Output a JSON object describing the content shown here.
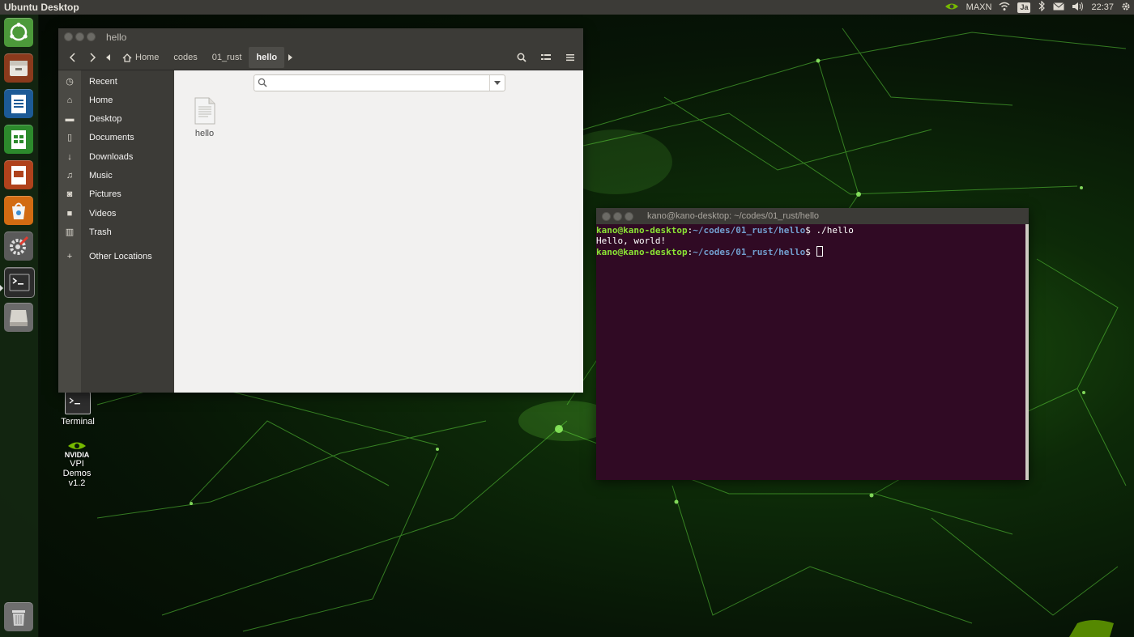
{
  "top_panel": {
    "title": "Ubuntu Desktop",
    "power_mode": "MAXN",
    "keyboard": "Ja",
    "clock": "22:37"
  },
  "launcher": {
    "items": [
      {
        "name": "ubuntu-dash-icon"
      },
      {
        "name": "files-icon"
      },
      {
        "name": "writer-icon"
      },
      {
        "name": "calc-icon"
      },
      {
        "name": "impress-icon"
      },
      {
        "name": "software-icon"
      },
      {
        "name": "settings-icon"
      },
      {
        "name": "terminal-icon"
      },
      {
        "name": "drive-icon"
      },
      {
        "name": "trash-icon"
      }
    ]
  },
  "desktop": {
    "icons": [
      {
        "label": "Terminal"
      },
      {
        "brand": "NVIDIA",
        "label": "VPI Demos v1.2"
      }
    ]
  },
  "files_window": {
    "title": "hello",
    "breadcrumbs": [
      "Home",
      "codes",
      "01_rust",
      "hello"
    ],
    "sidebar": [
      {
        "icon": "clock-icon",
        "label": "Recent"
      },
      {
        "icon": "home-icon",
        "label": "Home"
      },
      {
        "icon": "folder-icon",
        "label": "Desktop"
      },
      {
        "icon": "document-icon",
        "label": "Documents"
      },
      {
        "icon": "download-icon",
        "label": "Downloads"
      },
      {
        "icon": "music-icon",
        "label": "Music"
      },
      {
        "icon": "camera-icon",
        "label": "Pictures"
      },
      {
        "icon": "video-icon",
        "label": "Videos"
      },
      {
        "icon": "trash-icon",
        "label": "Trash"
      },
      {
        "icon": "plus-icon",
        "label": "Other Locations"
      }
    ],
    "search": {
      "placeholder": ""
    },
    "files": [
      {
        "name": "hello"
      }
    ]
  },
  "terminal": {
    "title": "kano@kano-desktop: ~/codes/01_rust/hello",
    "lines": [
      {
        "user": "kano@kano-desktop",
        "sep": ":",
        "path": "~/codes/01_rust/hello",
        "cmd": "$ ./hello"
      },
      {
        "output": "Hello, world!"
      },
      {
        "user": "kano@kano-desktop",
        "sep": ":",
        "path": "~/codes/01_rust/hello",
        "cmd": "$ "
      }
    ]
  }
}
